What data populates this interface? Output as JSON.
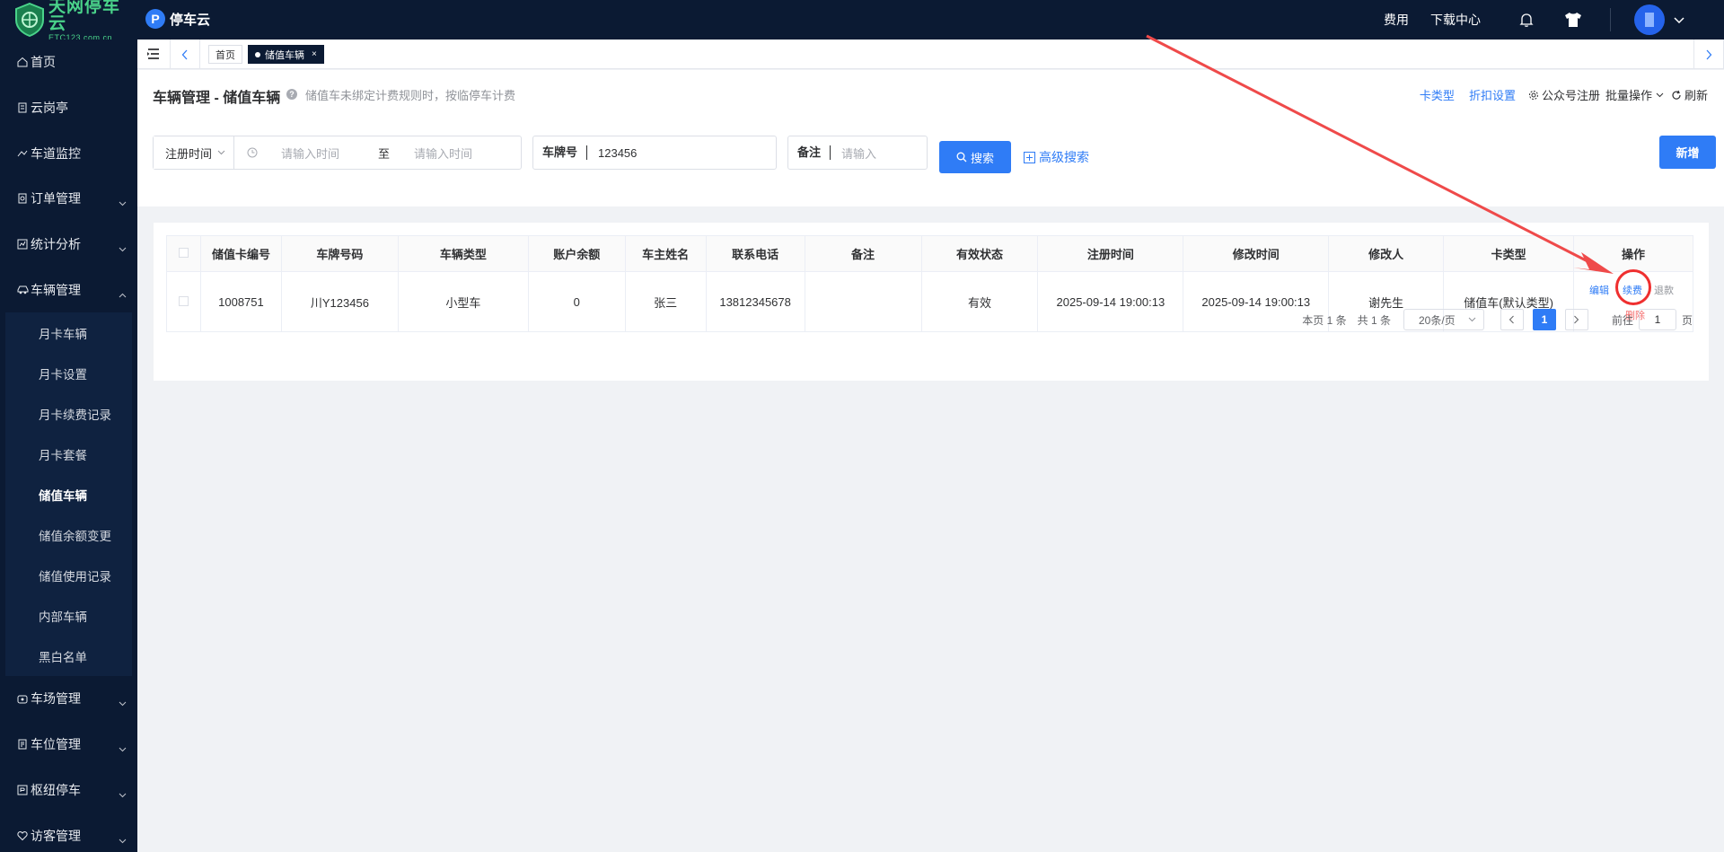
{
  "logo": {
    "name_cn": "天网停车云",
    "name_en": "ETC123.com.cn"
  },
  "brand": {
    "letter": "P",
    "name": "停车云"
  },
  "topnav": {
    "fee": "费用",
    "download": "下载中心"
  },
  "sidebar": {
    "items": [
      {
        "label": "首页"
      },
      {
        "label": "云岗亭"
      },
      {
        "label": "车道监控"
      },
      {
        "label": "订单管理"
      },
      {
        "label": "统计分析"
      },
      {
        "label": "车辆管理"
      }
    ],
    "submenu": [
      "月卡车辆",
      "月卡设置",
      "月卡续费记录",
      "月卡套餐",
      "储值车辆",
      "储值余额变更",
      "储值使用记录",
      "内部车辆",
      "黑白名单"
    ],
    "items_after": [
      {
        "label": "车场管理"
      },
      {
        "label": "车位管理"
      },
      {
        "label": "枢纽停车"
      },
      {
        "label": "访客管理"
      }
    ]
  },
  "tabs": {
    "home": "首页",
    "current": "储值车辆",
    "close": "×"
  },
  "page": {
    "title": "车辆管理 - 储值车辆",
    "tip": "储值车未绑定计费规则时，按临停车计费",
    "actions": {
      "card_type": "卡类型",
      "discount": "折扣设置",
      "wechat": "公众号注册",
      "batch": "批量操作",
      "refresh": "刷新"
    }
  },
  "filters": {
    "time_select": "注册时间",
    "start_placeholder": "请输入时间",
    "to": "至",
    "end_placeholder": "请输入时间",
    "plate_label": "车牌号",
    "plate_value": "123456",
    "remark_label": "备注",
    "remark_placeholder": "请输入",
    "search": "搜索",
    "advanced": "高级搜索",
    "add": "新增"
  },
  "table": {
    "headers": [
      "储值卡编号",
      "车牌号码",
      "车辆类型",
      "账户余额",
      "车主姓名",
      "联系电话",
      "备注",
      "有效状态",
      "注册时间",
      "修改时间",
      "修改人",
      "卡类型",
      "操作"
    ],
    "rows": [
      {
        "card_no": "1008751",
        "plate": "川Y123456",
        "vehicle_type": "小型车",
        "balance": "0",
        "owner": "张三",
        "phone": "13812345678",
        "remark": "",
        "status": "有效",
        "registered": "2025-09-14 19:00:13",
        "modified": "2025-09-14 19:00:13",
        "modifier": "谢先生",
        "card_type": "储值车(默认类型)",
        "ops": {
          "edit": "编辑",
          "renew": "续费",
          "refund": "退款",
          "delete": "删除"
        }
      }
    ]
  },
  "pager": {
    "page_count": "本页 1 条",
    "total": "共 1 条",
    "size": "20条/页",
    "current": "1",
    "goto": "前往",
    "goto_value": "1",
    "page_unit": "页"
  },
  "colors": {
    "accent": "#2f7cf6",
    "nav_bg": "#0b1a33",
    "danger": "#f56c6c",
    "annotation": "#ef2f2f"
  }
}
